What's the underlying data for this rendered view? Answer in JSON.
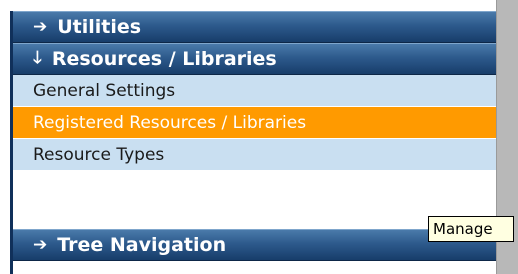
{
  "menu": {
    "utilities": {
      "label": "Utilities",
      "icon": "arrow-right-icon",
      "arrow": "➔"
    },
    "resources": {
      "label": "Resources / Libraries",
      "icon": "arrow-down-icon",
      "arrow": "🡓"
    },
    "items": [
      {
        "label": "General Settings",
        "active": false
      },
      {
        "label": "Registered Resources / Libraries",
        "active": true
      },
      {
        "label": "Resource Types",
        "active": false
      }
    ],
    "tree": {
      "label": "Tree Navigation",
      "icon": "arrow-right-icon",
      "arrow": "➔"
    }
  },
  "tooltip": {
    "text": "Manage"
  },
  "colors": {
    "header": "#2d5a8c",
    "item_background": "#c9dff1",
    "active_item": "#ff9a00"
  }
}
